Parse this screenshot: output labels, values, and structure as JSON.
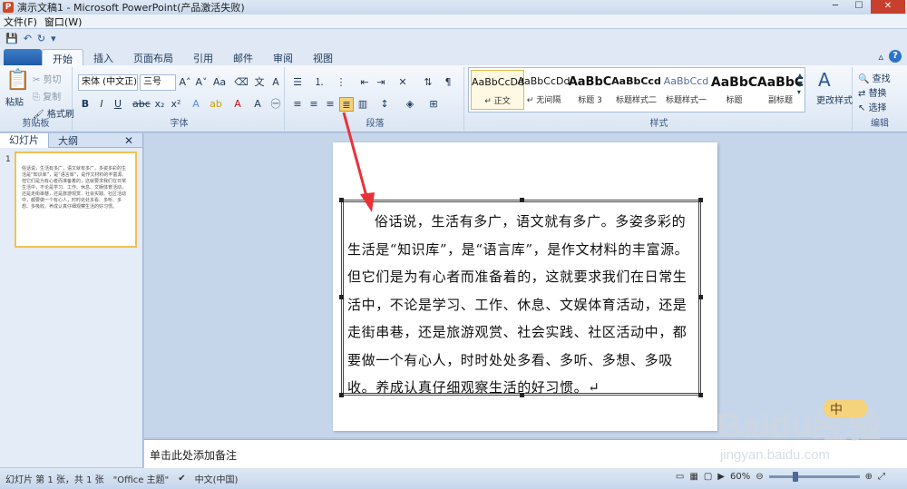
{
  "window": {
    "title": "演示文稿1 - Microsoft PowerPoint(产品激活失败)",
    "app_icon": "P"
  },
  "menu": [
    "文件(F)",
    "窗口(W)"
  ],
  "tabs": [
    "文件",
    "开始",
    "插入",
    "页面布局",
    "引用",
    "邮件",
    "审阅",
    "视图"
  ],
  "active_tab": "开始",
  "clipboard": {
    "paste": "粘贴",
    "cut": "剪切",
    "copy": "复制",
    "format_painter": "格式刷",
    "label": "剪贴板"
  },
  "font": {
    "name": "宋体 (中文正)",
    "size": "三号",
    "label": "字体"
  },
  "paragraph": {
    "label": "段落"
  },
  "styles": {
    "label": "样式",
    "items": [
      {
        "sample": "AaBbCcDd",
        "name": "↵ 正文"
      },
      {
        "sample": "AaBbCcDd",
        "name": "↵ 无间隔"
      },
      {
        "sample": "AaBbC",
        "name": "标题 3"
      },
      {
        "sample": "AaBbCcd",
        "name": "标题样式二"
      },
      {
        "sample": "AaBbCcd",
        "name": "标题样式一"
      },
      {
        "sample": "AaBbC",
        "name": "标题"
      },
      {
        "sample": "AaBbC",
        "name": "副标题"
      }
    ],
    "change": "更改样式"
  },
  "editing": {
    "label": "编辑",
    "find": "查找",
    "replace": "替换",
    "select": "选择"
  },
  "sidebar": {
    "tab_slides": "幻灯片",
    "tab_outline": "大纲",
    "thumb_number": "1",
    "thumb_text": "俗话说，生活有多广，语文就有多广。多姿多彩的生活是“知识库”，是“语言库”，是作文材料的丰富源。但它们是为有心者而准备着的，这就要求我们在日常生活中，不论是学习、工作、休息、文娱体育活动，还是走街串巷，还是旅游观赏、社会实践、社区活动中，都要做一个有心人，时时处处多看、多听、多想、多吸收。养成认真仔细观察生活的好习惯。"
  },
  "slide": {
    "text": "俗话说，生活有多广，语文就有多广。多姿多彩的生活是“知识库”，是“语言库”，是作文材料的丰富源。但它们是为有心者而准备着的，这就要求我们在日常生活中，不论是学习、工作、休息、文娱体育活动，还是走街串巷，还是旅游观赏、社会实践、社区活动中，都要做一个有心人，时时处处多看、多听、多想、多吸收。养成认真仔细观察生活的好习惯。↵"
  },
  "notes": {
    "placeholder": "单击此处添加备注"
  },
  "status": {
    "slide_info": "幻灯片 第 1 张，共 1 张",
    "theme": "\"Office 主题\"",
    "language": "中文(中国)",
    "zoom": "60%"
  },
  "zoom_level": 0.6,
  "colors": {
    "accent": "#2b5797",
    "arrow": "#e8323a",
    "selected_style": "#e5b74b"
  },
  "watermark": {
    "brand": "Baidu经验",
    "url": "jingyan.baidu.com",
    "ime": "中"
  }
}
